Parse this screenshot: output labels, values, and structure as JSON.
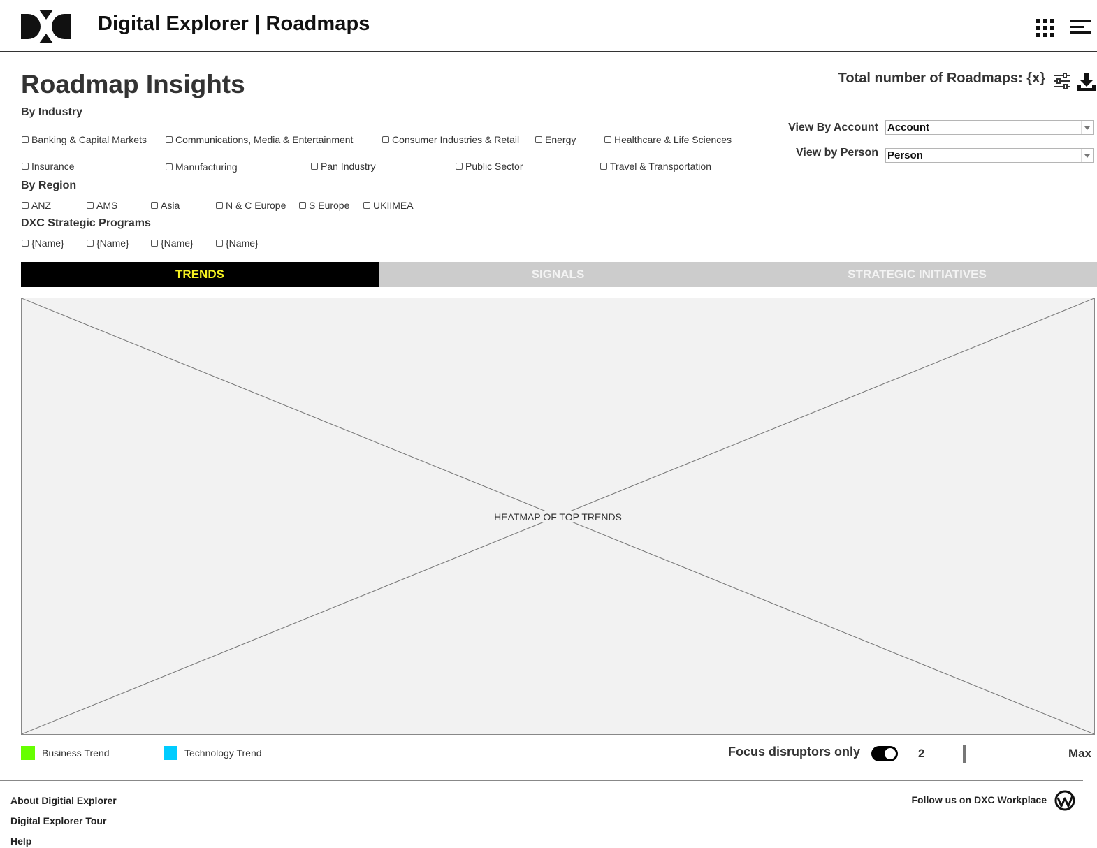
{
  "header": {
    "title": "Digital Explorer | Roadmaps",
    "logo_icon": "dxc-logo-icon",
    "apps_icon": "grid-icon",
    "menu_icon": "hamburger-menu-icon"
  },
  "page": {
    "title": "Roadmap Insights",
    "total_label": "Total number of Roadmaps: {x}"
  },
  "filters": {
    "industry_label": "By Industry",
    "industries": [
      "Banking & Capital Markets",
      "Communications, Media & Entertainment",
      "Consumer Industries & Retail",
      "Energy",
      "Healthcare & Life Sciences",
      "Insurance",
      "Manufacturing",
      "Pan Industry",
      "Public Sector",
      "Travel & Transportation"
    ],
    "region_label": "By Region",
    "regions": [
      "ANZ",
      "AMS",
      "Asia",
      "N & C Europe",
      "S Europe",
      "UKIIMEA"
    ],
    "programs_label": "DXC Strategic Programs",
    "programs": [
      "{Name}",
      "{Name}",
      "{Name}",
      "{Name}"
    ]
  },
  "views": {
    "account_label": "View By Account",
    "account_value": "Account",
    "person_label": "View by Person",
    "person_value": "Person"
  },
  "tabs": [
    "TRENDS",
    "SIGNALS",
    "STRATEGIC INITIATIVES"
  ],
  "active_tab": "TRENDS",
  "heatmap": {
    "placeholder": "HEATMAP OF TOP TRENDS"
  },
  "legend": {
    "items": [
      {
        "label": "Business Trend",
        "color": "#66ff00"
      },
      {
        "label": "Technology Trend",
        "color": "#00ccff"
      }
    ]
  },
  "controls": {
    "focus_label": "Focus disruptors only",
    "focus_enabled": true,
    "slider_min": "2",
    "slider_max": "Max",
    "slider_value_fraction": 0.2
  },
  "footer": {
    "links": [
      "About Digitial Explorer",
      "Digital Explorer Tour",
      "Help"
    ],
    "follow_text": "Follow us on",
    "follow_link": "DXC Workplace"
  },
  "colors": {
    "tab_active_bg": "#000000",
    "tab_active_text": "#f5f122",
    "tab_inactive_bg": "#cccccc"
  }
}
